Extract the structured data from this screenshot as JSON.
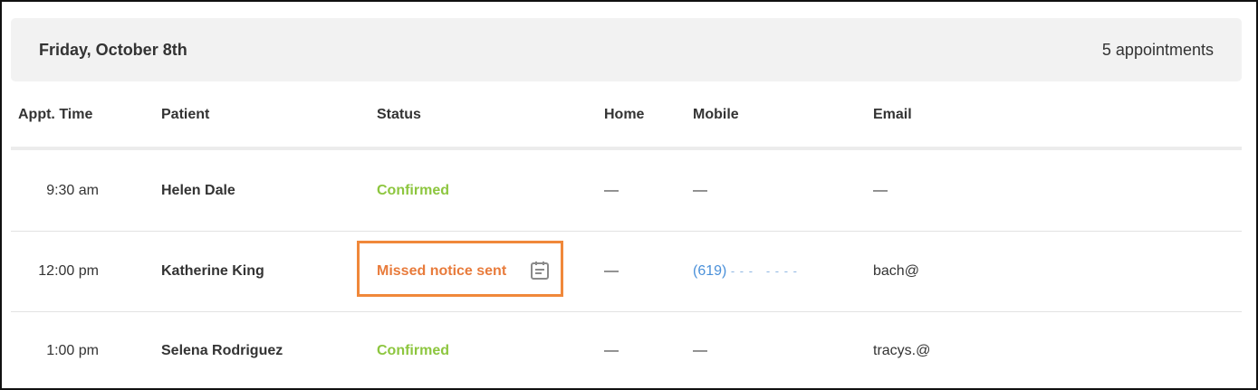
{
  "header": {
    "date": "Friday, October 8th",
    "count": "5 appointments"
  },
  "columns": {
    "time": "Appt. Time",
    "patient": "Patient",
    "status": "Status",
    "home": "Home",
    "mobile": "Mobile",
    "email": "Email"
  },
  "rows": [
    {
      "time": "9:30 am",
      "patient": "Helen Dale",
      "status": "Confirmed",
      "home": "—",
      "mobile": "—",
      "email": "—"
    },
    {
      "time": "12:00 pm",
      "patient": "Katherine King",
      "status": "Missed notice sent",
      "home": "—",
      "mobile_area": "(619)",
      "mobile_mask": "- - -   - - - -",
      "email": "bach@"
    },
    {
      "time": "1:00 pm",
      "patient": "Selena Rodriguez",
      "status": "Confirmed",
      "home": "—",
      "mobile": "—",
      "email": "tracys.@"
    }
  ],
  "colors": {
    "confirmed": "#8dc63f",
    "missed": "#e87b3b",
    "highlight": "#f0883a",
    "link": "#4a90d9"
  },
  "icons": {
    "note": "notes-icon"
  }
}
